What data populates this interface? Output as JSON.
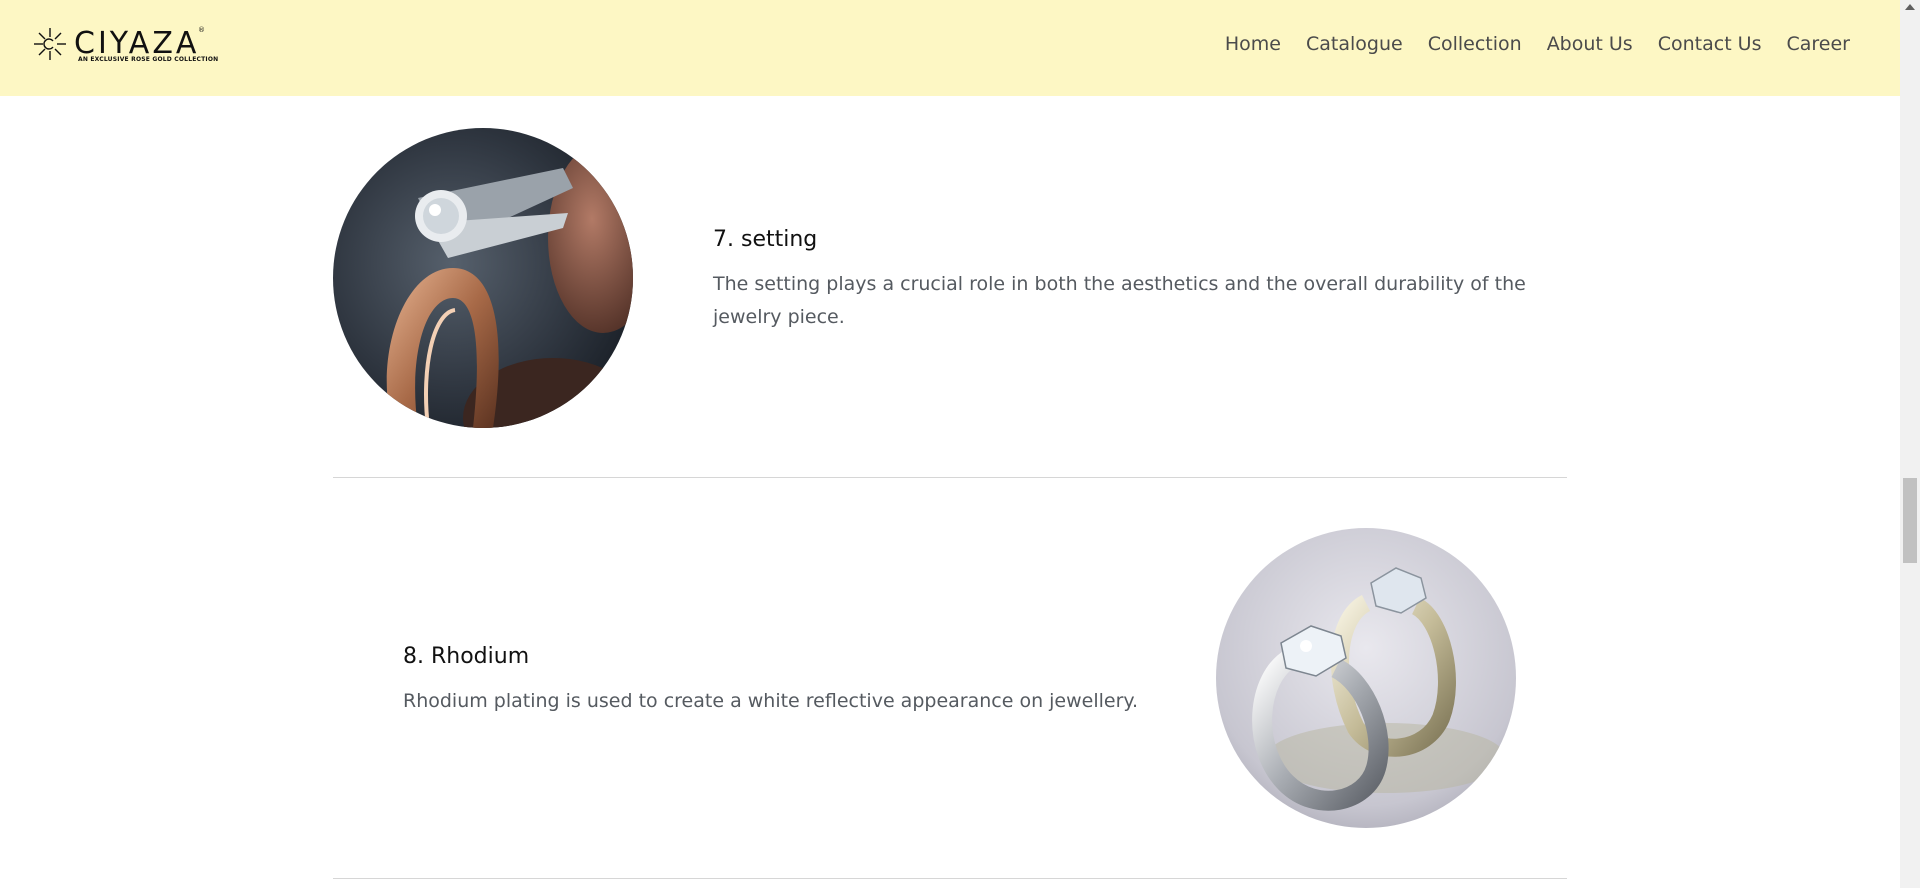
{
  "brand": {
    "name": "CIYAZA",
    "registered": "®",
    "tagline": "AN EXCLUSIVE ROSE GOLD COLLECTION"
  },
  "nav": {
    "links": [
      "Home",
      "Catalogue",
      "Collection",
      "About Us",
      "Contact Us",
      "Career"
    ]
  },
  "items": [
    {
      "title": "7. setting",
      "description": "The setting plays a crucial role in both the aesthetics and the overall durability of the jewelry piece.",
      "image": "rose-gold-ring-setting-photo"
    },
    {
      "title": "8. Rhodium",
      "description": "Rhodium plating is used to create a white reflective appearance on jewellery.",
      "image": "rhodium-plated-rings-photo"
    }
  ],
  "colors": {
    "navbar_bg": "#fdf7c4",
    "nav_text": "#4b4b4b",
    "divider": "#d6d6d6",
    "body_text": "#555a60"
  }
}
